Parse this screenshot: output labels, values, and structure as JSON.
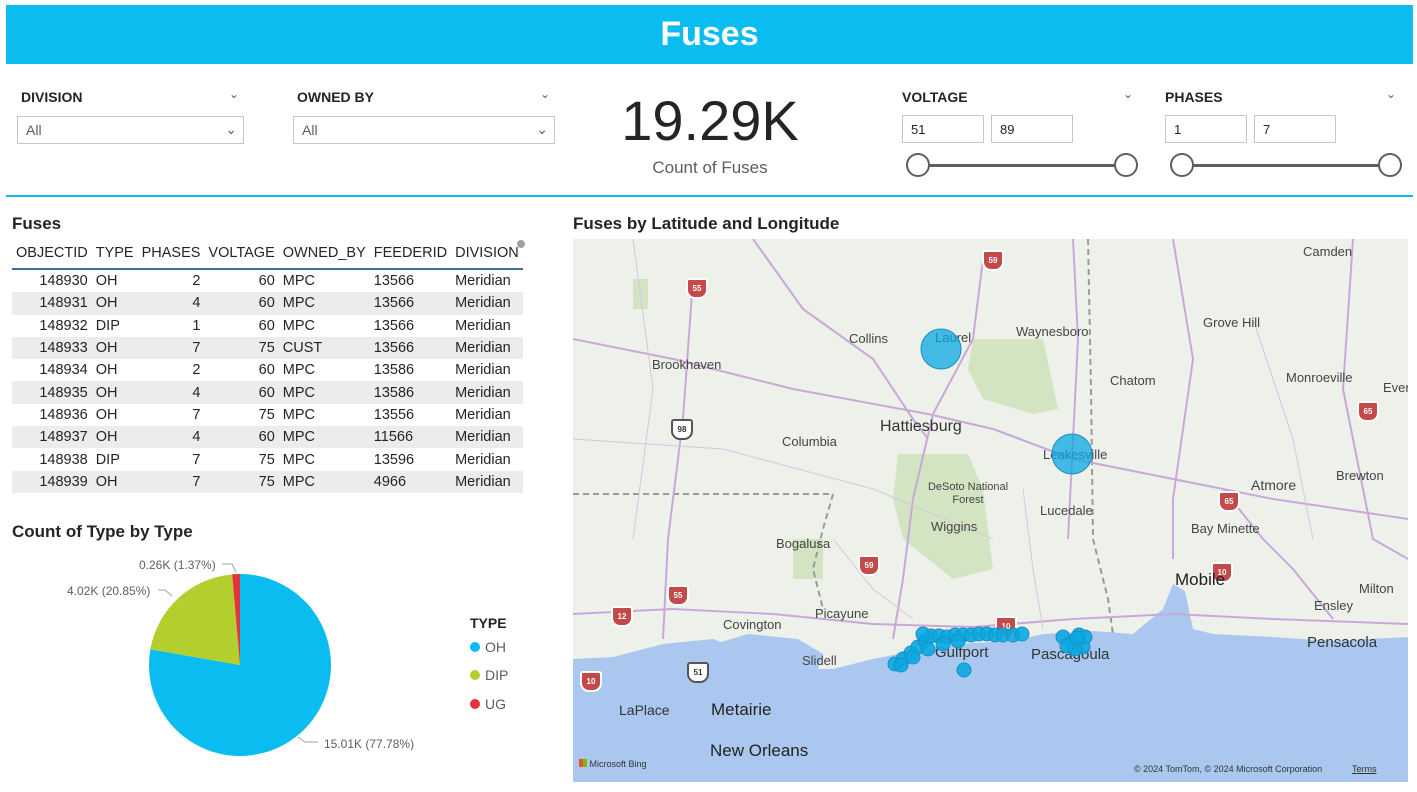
{
  "banner": {
    "title": "Fuses"
  },
  "slicers": {
    "division": {
      "title": "DIVISION",
      "value": "All"
    },
    "owned_by": {
      "title": "OWNED BY",
      "value": "All"
    },
    "voltage": {
      "title": "VOLTAGE",
      "min": "51",
      "max": "89"
    },
    "phases": {
      "title": "PHASES",
      "min": "1",
      "max": "7"
    }
  },
  "kpi": {
    "value": "19.29K",
    "label": "Count of Fuses"
  },
  "table": {
    "title": "Fuses",
    "columns": [
      "OBJECTID",
      "TYPE",
      "PHASES",
      "VOLTAGE",
      "OWNED_BY",
      "FEEDERID",
      "DIVISION"
    ],
    "rows": [
      [
        "148930",
        "OH",
        "2",
        "60",
        "MPC",
        "13566",
        "Meridian"
      ],
      [
        "148931",
        "OH",
        "4",
        "60",
        "MPC",
        "13566",
        "Meridian"
      ],
      [
        "148932",
        "DIP",
        "1",
        "60",
        "MPC",
        "13566",
        "Meridian"
      ],
      [
        "148933",
        "OH",
        "7",
        "75",
        "CUST",
        "13566",
        "Meridian"
      ],
      [
        "148934",
        "OH",
        "2",
        "60",
        "MPC",
        "13586",
        "Meridian"
      ],
      [
        "148935",
        "OH",
        "4",
        "60",
        "MPC",
        "13586",
        "Meridian"
      ],
      [
        "148936",
        "OH",
        "7",
        "75",
        "MPC",
        "13556",
        "Meridian"
      ],
      [
        "148937",
        "OH",
        "4",
        "60",
        "MPC",
        "11566",
        "Meridian"
      ],
      [
        "148938",
        "DIP",
        "7",
        "75",
        "MPC",
        "13596",
        "Meridian"
      ],
      [
        "148939",
        "OH",
        "7",
        "75",
        "MPC",
        "4966",
        "Meridian"
      ]
    ]
  },
  "pie": {
    "title": "Count of Type by Type",
    "legend_title": "TYPE",
    "slices": [
      {
        "name": "OH",
        "label": "15.01K (77.78%)",
        "percent": 77.78,
        "color": "#0abcf0"
      },
      {
        "name": "DIP",
        "label": "4.02K (20.85%)",
        "percent": 20.85,
        "color": "#b3cf2d"
      },
      {
        "name": "UG",
        "label": "0.26K (1.37%)",
        "percent": 1.37,
        "color": "#e3333c"
      }
    ]
  },
  "map": {
    "title": "Fuses by Latitude and Longitude",
    "places": {
      "camden": "Camden",
      "laurel": "Laurel",
      "collins": "Collins",
      "waynesboro": "Waynesboro",
      "grove_hill": "Grove Hill",
      "brookhaven": "Brookhaven",
      "chatom": "Chatom",
      "monroeville": "Monroeville",
      "evergreen": "Evergre",
      "hattiesburg": "Hattiesburg",
      "columbia": "Columbia",
      "leakesville": "Leakesville",
      "brewton": "Brewton",
      "desoto": "DeSoto National Forest",
      "atmore": "Atmore",
      "lucedale": "Lucedale",
      "wiggins": "Wiggins",
      "bay_minette": "Bay Minette",
      "bogalusa": "Bogalusa",
      "mobile": "Mobile",
      "milton": "Milton",
      "picayune": "Picayune",
      "ensley": "Ensley",
      "covington": "Covington",
      "pensacola": "Pensacola",
      "slidell": "Slidell",
      "gulfport": "Gulfport",
      "pascagoula": "Pascagoula",
      "laplace": "LaPlace",
      "metairie": "Metairie",
      "new_orleans": "New Orleans"
    },
    "shields": [
      "59",
      "55",
      "98",
      "65",
      "65",
      "59",
      "55",
      "12",
      "10",
      "10",
      "51",
      "10"
    ],
    "provider": "Microsoft Bing",
    "copyright": "© 2024 TomTom, © 2024 Microsoft Corporation",
    "terms": "Terms",
    "bubble_color": "#0aa8e0"
  }
}
